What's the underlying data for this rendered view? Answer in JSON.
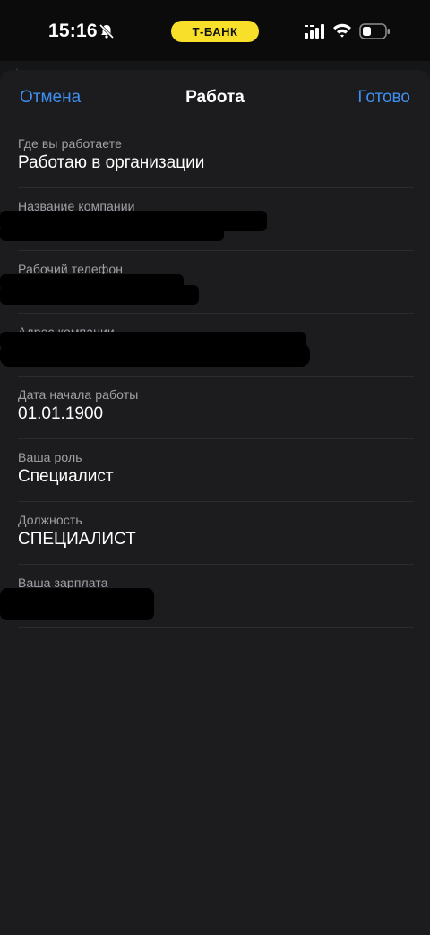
{
  "status_bar": {
    "time": "15:16",
    "bank_label": "Т-БАНК",
    "icons": [
      "bell-slash-icon",
      "cellular-signal-icon",
      "wifi-icon",
      "battery-icon"
    ]
  },
  "nav": {
    "cancel_label": "Отмена",
    "title": "Работа",
    "done_label": "Готово"
  },
  "fields": [
    {
      "label": "Где вы работаете",
      "value": "Работаю в организации"
    },
    {
      "label": "Название компании",
      "value": ""
    },
    {
      "label": "Рабочий телефон",
      "value": ""
    },
    {
      "label": "Адрес компании",
      "value": ""
    },
    {
      "label": "Дата начала работы",
      "value": "01.01.1900"
    },
    {
      "label": "Ваша роль",
      "value": "Специалист"
    },
    {
      "label": "Должность",
      "value": "СПЕЦИАЛИСТ"
    },
    {
      "label": "Ваша зарплата",
      "value": ""
    }
  ],
  "colors": {
    "accent": "#3e8ff0",
    "sheet_background": "#1c1c1e",
    "bank_pill": "#f7df2a"
  }
}
